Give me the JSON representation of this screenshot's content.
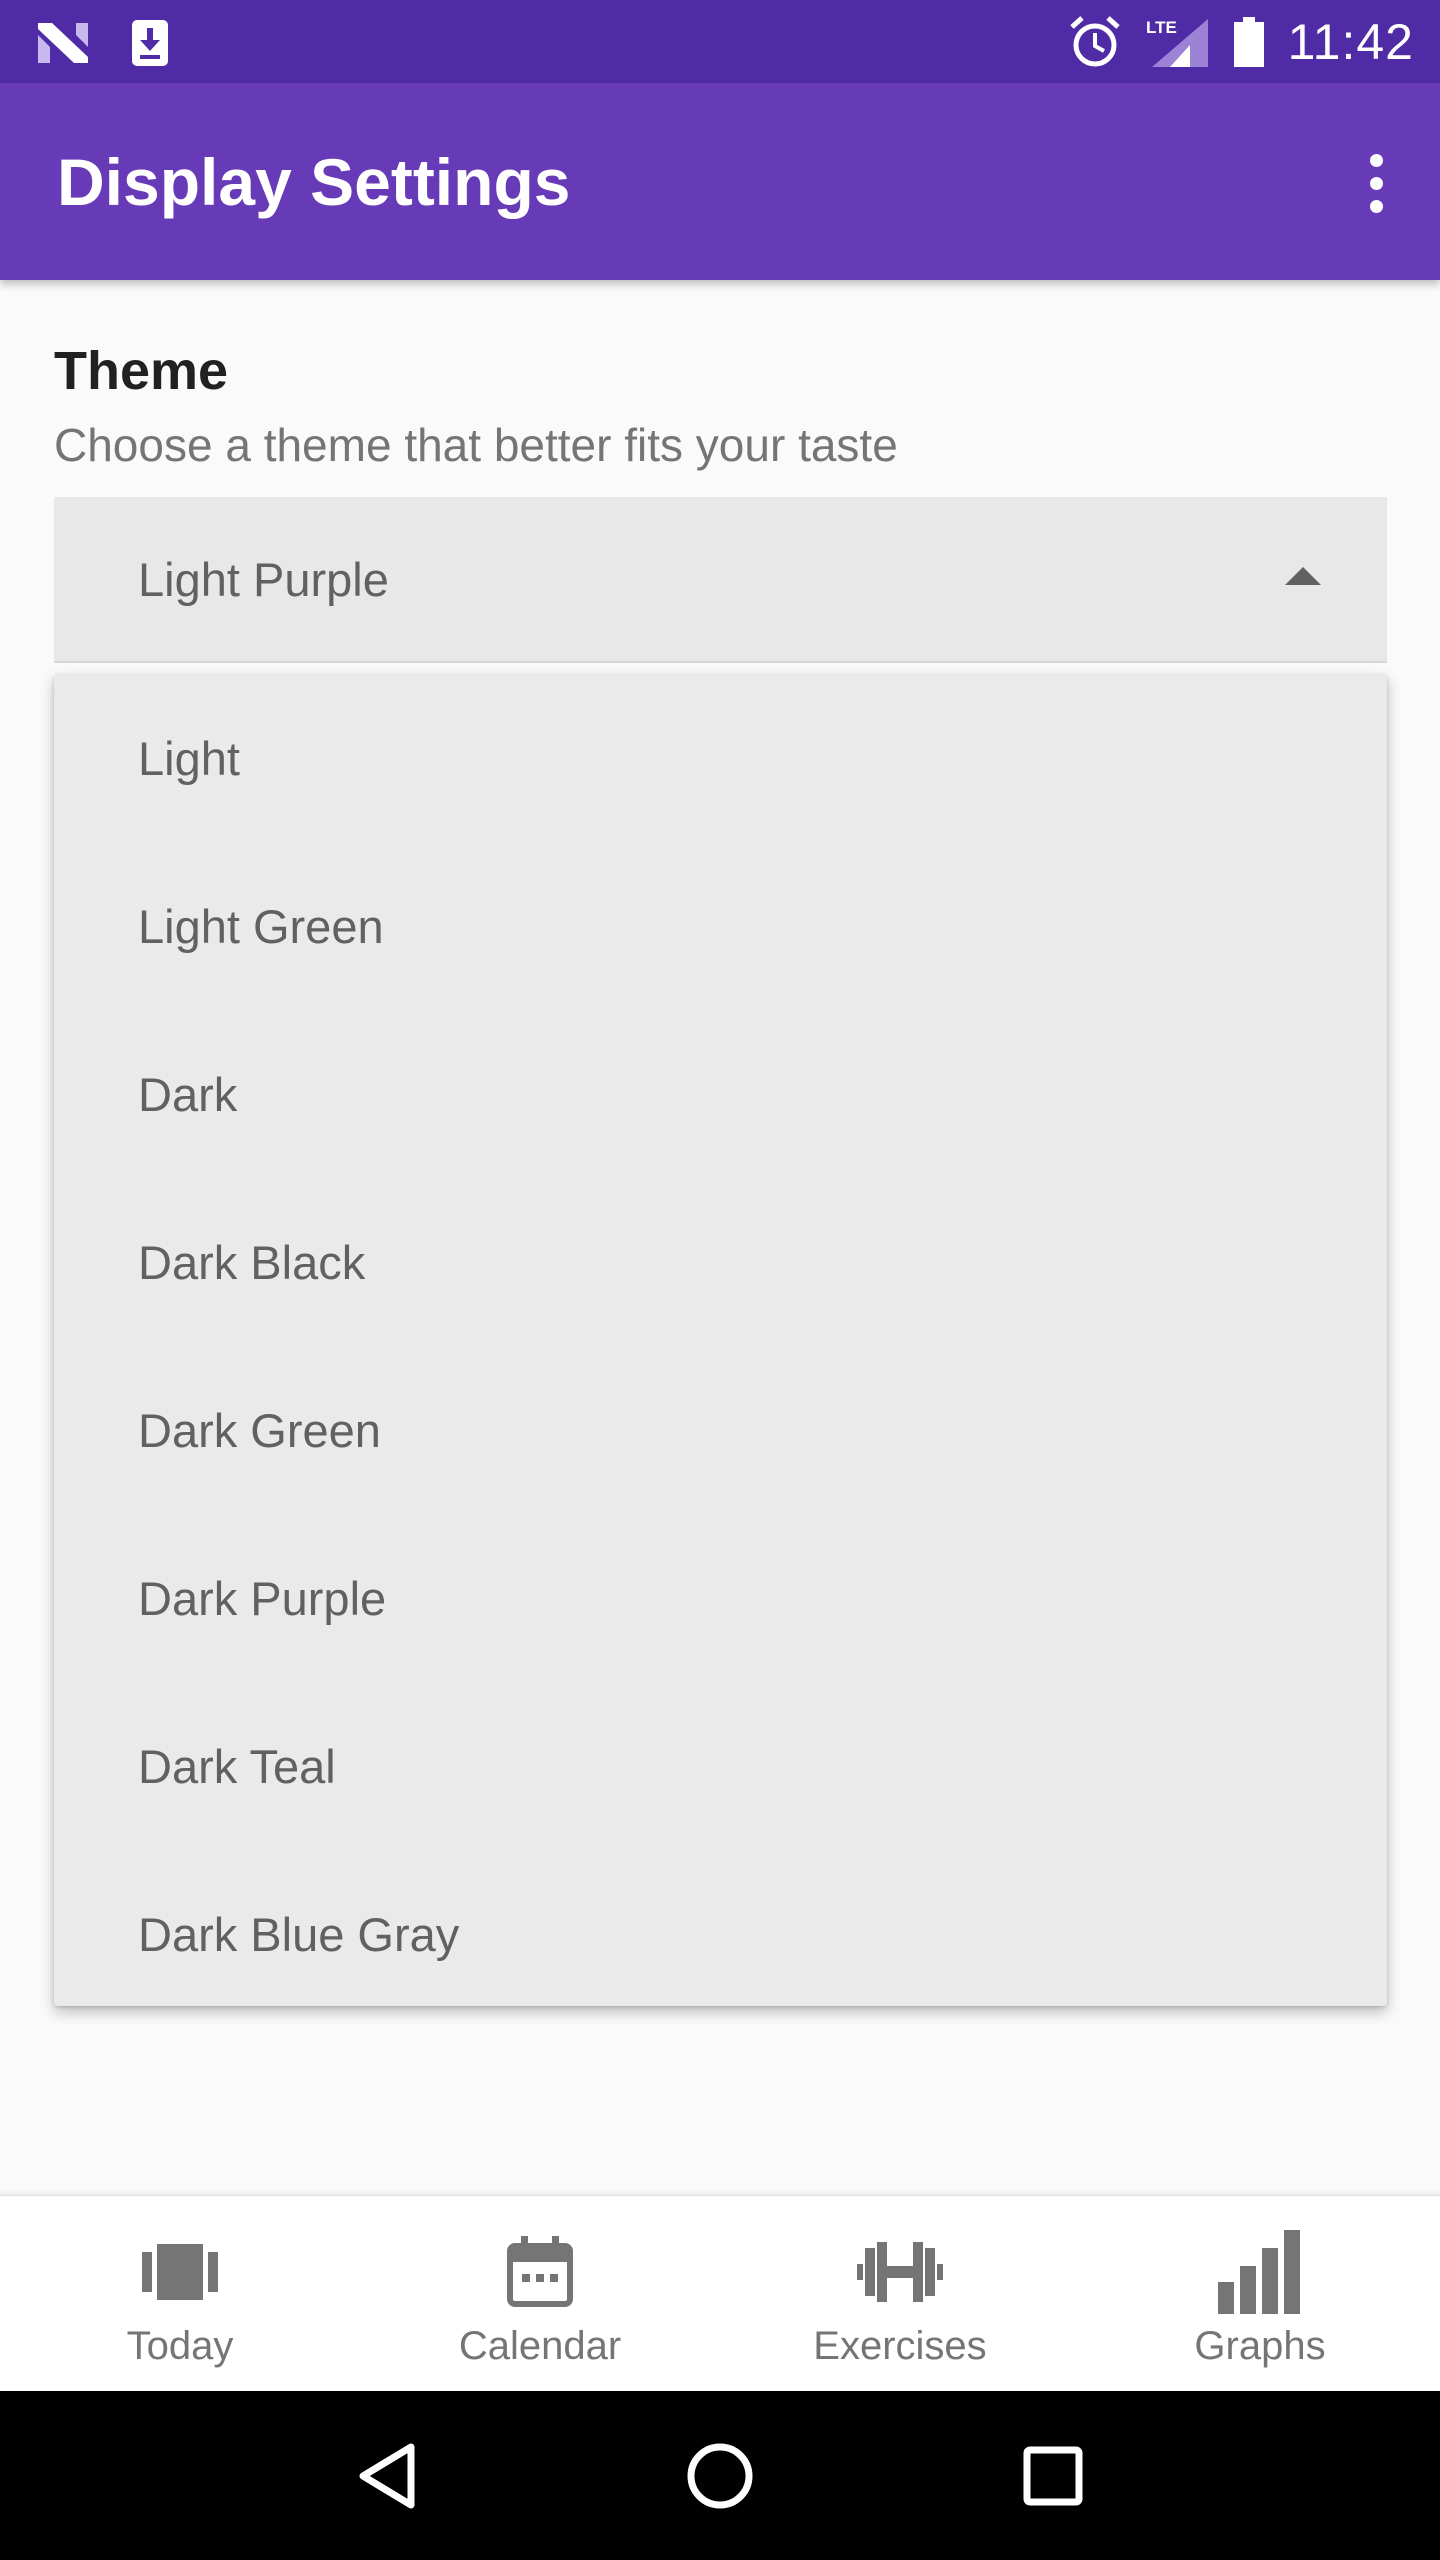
{
  "status_bar": {
    "time": "11:42",
    "network": "LTE",
    "icons": [
      "n-logo-icon",
      "download-icon",
      "alarm-icon",
      "signal-icon",
      "battery-icon"
    ]
  },
  "app_bar": {
    "title": "Display Settings",
    "overflow_icon": "more-vert-icon"
  },
  "theme_setting": {
    "title": "Theme",
    "subtitle": "Choose a theme that better fits your taste",
    "selected": "Light Purple",
    "options": [
      "Light",
      "Light Green",
      "Dark",
      "Dark Black",
      "Dark Green",
      "Dark Purple",
      "Dark Teal",
      "Dark Blue Gray"
    ]
  },
  "bottom_nav": {
    "items": [
      {
        "label": "Today",
        "icon": "today-cards-icon"
      },
      {
        "label": "Calendar",
        "icon": "calendar-icon"
      },
      {
        "label": "Exercises",
        "icon": "dumbbell-icon"
      },
      {
        "label": "Graphs",
        "icon": "bar-chart-icon"
      }
    ]
  },
  "system_nav": {
    "icons": [
      "back-icon",
      "home-icon",
      "recents-icon"
    ]
  },
  "colors": {
    "status_bar": "#4f2ba6",
    "app_bar": "#673ab7",
    "background": "#fafafa",
    "dropdown": "#e8e8e8",
    "nav_icon": "#757575"
  }
}
